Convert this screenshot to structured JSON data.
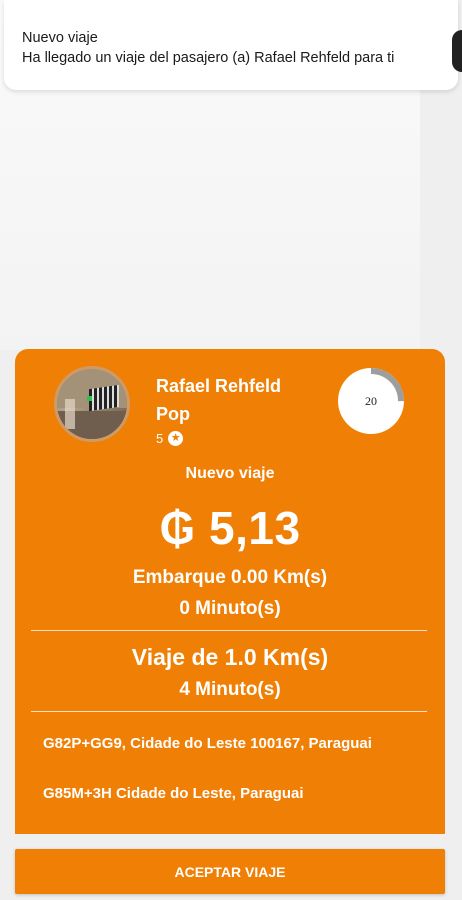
{
  "notification": {
    "title": "Nuevo viaje",
    "body": "Ha llegado un viaje del pasajero (a) Rafael Rehfeld para ti"
  },
  "offer": {
    "passenger_name": "Rafael Rehfeld",
    "service_type": "Pop",
    "rating": "5",
    "countdown": "20",
    "countdown_progress": 0.25,
    "trip_label": "Nuevo viaje",
    "price": "₲ 5,13",
    "pickup_distance": "Embarque 0.00 Km(s)",
    "pickup_time": "0 Minuto(s)",
    "trip_distance": "Viaje de  1.0 Km(s)",
    "trip_time": "4 Minuto(s)",
    "origin_address": "G82P+GG9, Cidade do Leste 100167, Paraguai",
    "destination_address": "G85M+3H Cidade do Leste, Paraguai",
    "accent_color": "#f07f06"
  },
  "actions": {
    "accept_label": "ACEPTAR VIAJE"
  },
  "icons": {
    "rating": "star-icon",
    "avatar": "passenger-photo"
  }
}
